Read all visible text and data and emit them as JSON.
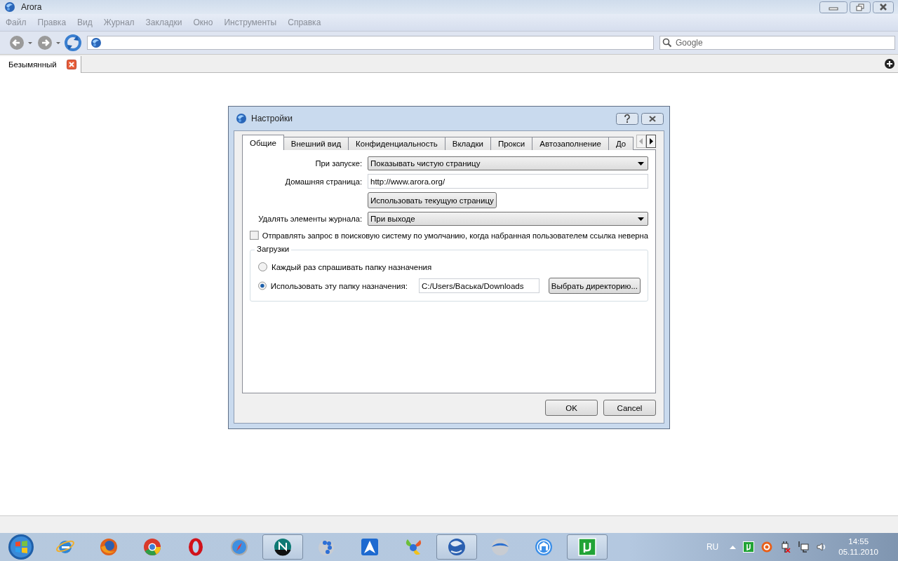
{
  "window": {
    "title": "Arora"
  },
  "menu": [
    "Файл",
    "Правка",
    "Вид",
    "Журнал",
    "Закладки",
    "Окно",
    "Инструменты",
    "Справка"
  ],
  "search": {
    "placeholder": "Google"
  },
  "tabs": [
    {
      "label": "Безымянный",
      "selected": true
    }
  ],
  "dialog": {
    "title": "Настройки",
    "tabs": [
      {
        "label": "Общие",
        "selected": true
      },
      {
        "label": "Внешний вид",
        "selected": false
      },
      {
        "label": "Конфиденциальность",
        "selected": false
      },
      {
        "label": "Вкладки",
        "selected": false
      },
      {
        "label": "Прокси",
        "selected": false
      },
      {
        "label": "Автозаполнение",
        "selected": false
      },
      {
        "label": "До",
        "selected": false
      }
    ],
    "startup": {
      "label": "При запуске:",
      "value": "Показывать чистую страницу"
    },
    "home_page": {
      "label": "Домашняя страница:",
      "value": "http://www.arora.org/"
    },
    "use_current_button": "Использовать текущую страницу",
    "clear_history": {
      "label": "Удалять элементы журнала:",
      "value": "При выходе"
    },
    "search_on_invalid": {
      "label": "Отправлять запрос в поисковую систему по умолчанию, когда набранная пользователем ссылка неверна",
      "checked": false
    },
    "downloads": {
      "title": "Загрузки",
      "options": [
        {
          "label": "Каждый раз спрашивать папку назначения",
          "selected": false
        },
        {
          "label": "Использовать эту папку назначения:",
          "selected": true
        }
      ],
      "folder": "C:/Users/Васька/Downloads",
      "choose_button": "Выбрать директорию..."
    },
    "buttons": [
      "OK",
      "Cancel"
    ]
  },
  "taskbar": {
    "items": [
      {
        "kind": "ie",
        "active": false
      },
      {
        "kind": "firefox",
        "active": false
      },
      {
        "kind": "chrome",
        "active": false
      },
      {
        "kind": "opera",
        "active": false
      },
      {
        "kind": "safari",
        "active": false
      },
      {
        "kind": "netscape",
        "active": true
      },
      {
        "kind": "blob",
        "active": false
      },
      {
        "kind": "arrow",
        "active": false
      },
      {
        "kind": "leaves",
        "active": false
      },
      {
        "kind": "globe",
        "active": true
      },
      {
        "kind": "sphere",
        "active": false
      },
      {
        "kind": "maxthon",
        "active": false
      },
      {
        "kind": "torrent",
        "active": true
      }
    ],
    "tray": {
      "language": "RU",
      "time": "14:55",
      "date": "05.11.2010"
    }
  }
}
